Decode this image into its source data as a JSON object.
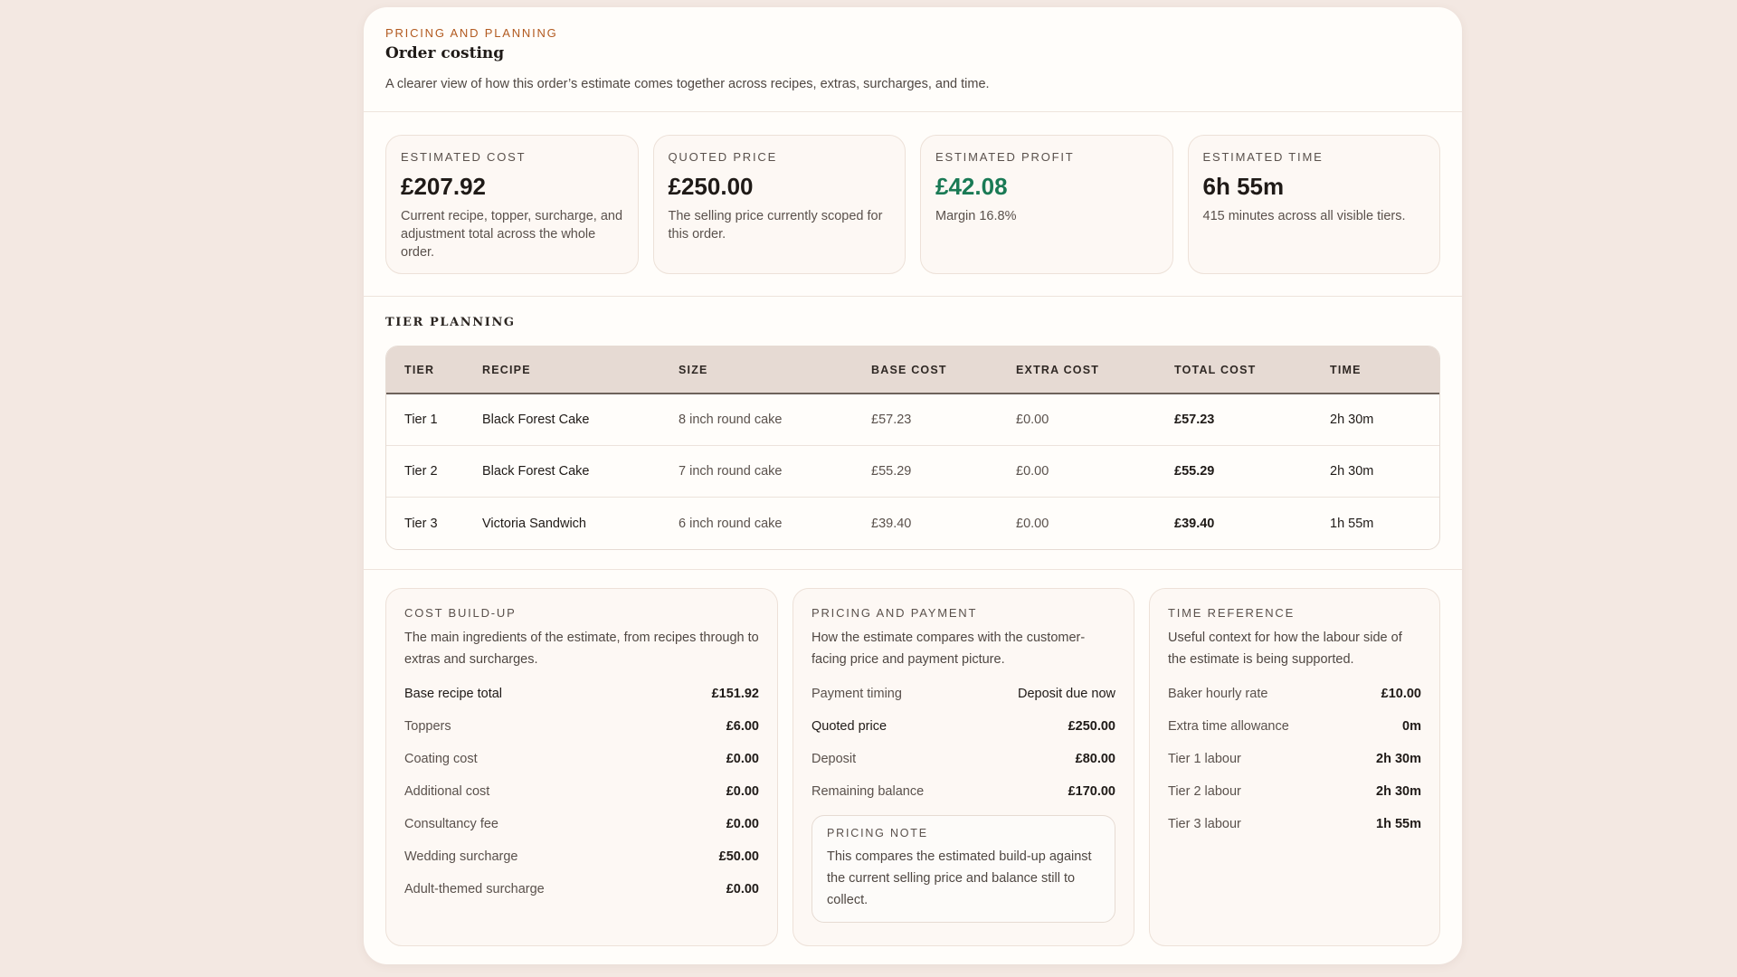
{
  "header": {
    "eyebrow": "PRICING AND PLANNING",
    "title": "Order costing",
    "subtitle": "A clearer view of how this order’s estimate comes together across recipes, extras, surcharges, and time."
  },
  "stats": [
    {
      "label": "ESTIMATED COST",
      "value": "£207.92",
      "desc": "Current recipe, topper, surcharge, and adjustment total across the whole order."
    },
    {
      "label": "QUOTED PRICE",
      "value": "£250.00",
      "desc": "The selling price currently scoped for this order."
    },
    {
      "label": "ESTIMATED PROFIT",
      "value": "£42.08",
      "desc": "Margin 16.8%"
    },
    {
      "label": "ESTIMATED TIME",
      "value": "6h 55m",
      "desc": "415 minutes across all visible tiers."
    }
  ],
  "tier_planning": {
    "heading": "TIER PLANNING",
    "columns": [
      "TIER",
      "RECIPE",
      "SIZE",
      "BASE COST",
      "EXTRA COST",
      "TOTAL COST",
      "TIME"
    ],
    "rows": [
      {
        "tier": "Tier 1",
        "recipe": "Black Forest Cake",
        "size": "8 inch round cake",
        "base": "£57.23",
        "extra": "£0.00",
        "total": "£57.23",
        "time": "2h 30m"
      },
      {
        "tier": "Tier 2",
        "recipe": "Black Forest Cake",
        "size": "7 inch round cake",
        "base": "£55.29",
        "extra": "£0.00",
        "total": "£55.29",
        "time": "2h 30m"
      },
      {
        "tier": "Tier 3",
        "recipe": "Victoria Sandwich",
        "size": "6 inch round cake",
        "base": "£39.40",
        "extra": "£0.00",
        "total": "£39.40",
        "time": "1h 55m"
      }
    ]
  },
  "cost_buildup": {
    "label": "COST BUILD-UP",
    "desc": "The main ingredients of the estimate, from recipes through to extras and surcharges.",
    "rows": [
      {
        "k": "Base recipe total",
        "v": "£151.92"
      },
      {
        "k": "Toppers",
        "v": "£6.00"
      },
      {
        "k": "Coating cost",
        "v": "£0.00"
      },
      {
        "k": "Additional cost",
        "v": "£0.00"
      },
      {
        "k": "Consultancy fee",
        "v": "£0.00"
      },
      {
        "k": "Wedding surcharge",
        "v": "£50.00"
      },
      {
        "k": "Adult-themed surcharge",
        "v": "£0.00"
      }
    ]
  },
  "pricing_payment": {
    "label": "PRICING AND PAYMENT",
    "desc": "How the estimate compares with the customer-facing price and payment picture.",
    "rows": [
      {
        "k": "Payment timing",
        "v": "Deposit due now"
      },
      {
        "k": "Quoted price",
        "v": "£250.00"
      },
      {
        "k": "Deposit",
        "v": "£80.00"
      },
      {
        "k": "Remaining balance",
        "v": "£170.00"
      }
    ],
    "note_label": "PRICING NOTE",
    "note_text": "This compares the estimated build-up against the current selling price and balance still to collect."
  },
  "time_reference": {
    "label": "TIME REFERENCE",
    "desc": "Useful context for how the labour side of the estimate is being supported.",
    "rows": [
      {
        "k": "Baker hourly rate",
        "v": "£10.00"
      },
      {
        "k": "Extra time allowance",
        "v": "0m"
      },
      {
        "k": "Tier 1 labour",
        "v": "2h 30m"
      },
      {
        "k": "Tier 2 labour",
        "v": "2h 30m"
      },
      {
        "k": "Tier 3 labour",
        "v": "1h 55m"
      }
    ]
  },
  "colors": {
    "accent": "#b25a20",
    "profit": "#1a7a55",
    "background": "#f3e8e2"
  }
}
